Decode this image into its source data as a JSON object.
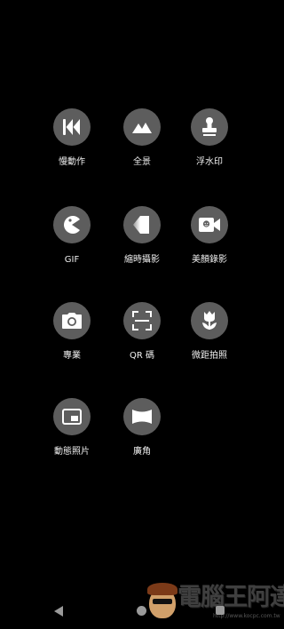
{
  "colors": {
    "background": "#000000",
    "icon_circle": "#5d5d5d",
    "icon_glyph": "#ffffff",
    "label_text": "#f0f0f0",
    "nav_buttons": "#9a9a9a"
  },
  "modes": [
    {
      "label": "慢動作",
      "icon": "slow-motion-icon"
    },
    {
      "label": "全景",
      "icon": "panorama-mountain-icon"
    },
    {
      "label": "浮水印",
      "icon": "watermark-stamp-icon"
    },
    {
      "label": "GIF",
      "icon": "gif-pacman-icon"
    },
    {
      "label": "縮時攝影",
      "icon": "timelapse-icon"
    },
    {
      "label": "美顏錄影",
      "icon": "beauty-video-icon"
    },
    {
      "label": "專業",
      "icon": "pro-camera-icon"
    },
    {
      "label": "QR 碼",
      "icon": "qr-scan-icon"
    },
    {
      "label": "微距拍照",
      "icon": "macro-tulip-icon"
    },
    {
      "label": "動態照片",
      "icon": "motion-photo-icon"
    },
    {
      "label": "廣角",
      "icon": "wide-angle-icon"
    }
  ],
  "navbar": {
    "back": "back-triangle-icon",
    "home": "home-circle-icon",
    "recents": "recents-square-icon"
  },
  "watermark": {
    "text": "電腦王阿達",
    "url": "http://www.kocpc.com.tw"
  }
}
